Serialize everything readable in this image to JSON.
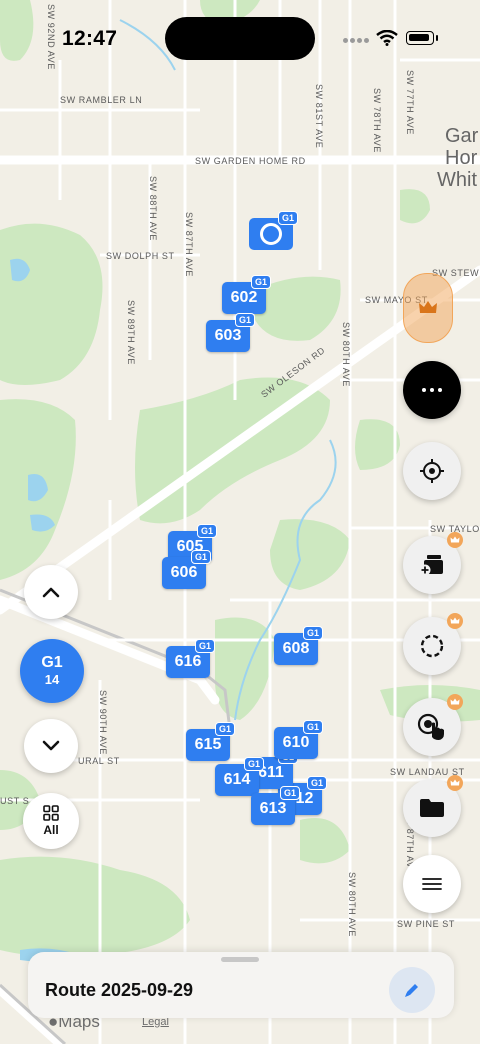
{
  "status_bar": {
    "time": "12:47"
  },
  "map": {
    "street_labels": [
      "SW 92ND AVE",
      "SW RAMBLER LN",
      "SW GARDEN HOME RD",
      "SW 81ST AVE",
      "SW 78TH AVE",
      "SW 77TH AVE",
      "SW 88TH AVE",
      "SW 87TH AVE",
      "SW DOLPH ST",
      "SW MAYO ST",
      "SW STEW",
      "SW 89TH AVE",
      "SW OLESON RD",
      "SW 80TH AVE",
      "SW TAYLO",
      "SW 90TH AVE",
      "SW LANDAU ST",
      "SW PINE ST",
      "UST S",
      "URAL ST"
    ],
    "area_label": [
      "Gar",
      "Hor",
      "Whit"
    ],
    "attribution": {
      "maps": "Maps",
      "legal": "Legal"
    }
  },
  "stops": [
    {
      "number": "602",
      "group": "G1"
    },
    {
      "number": "603",
      "group": "G1"
    },
    {
      "number": "605",
      "group": "G1"
    },
    {
      "number": "606",
      "group": "G1"
    },
    {
      "number": "616",
      "group": "G1"
    },
    {
      "number": "608",
      "group": "G1"
    },
    {
      "number": "615",
      "group": "G1"
    },
    {
      "number": "610",
      "group": "G1"
    },
    {
      "number": "614",
      "group": "G1"
    },
    {
      "number": "611",
      "group": "G1"
    },
    {
      "number": "612",
      "group": "G1"
    },
    {
      "number": "613",
      "group": "G1"
    }
  ],
  "current_location": {
    "group": "G1"
  },
  "group_selector": {
    "label": "G1",
    "count": "14",
    "all_label": "All"
  },
  "side_buttons": [
    "more-options",
    "recenter",
    "add-stop",
    "lasso-select",
    "tap-select",
    "folder",
    "menu"
  ],
  "route": {
    "title": "Route 2025-09-29"
  },
  "colors": {
    "accent": "#2f7ef0",
    "premium": "#f2a65a",
    "park": "#cde8c0"
  }
}
